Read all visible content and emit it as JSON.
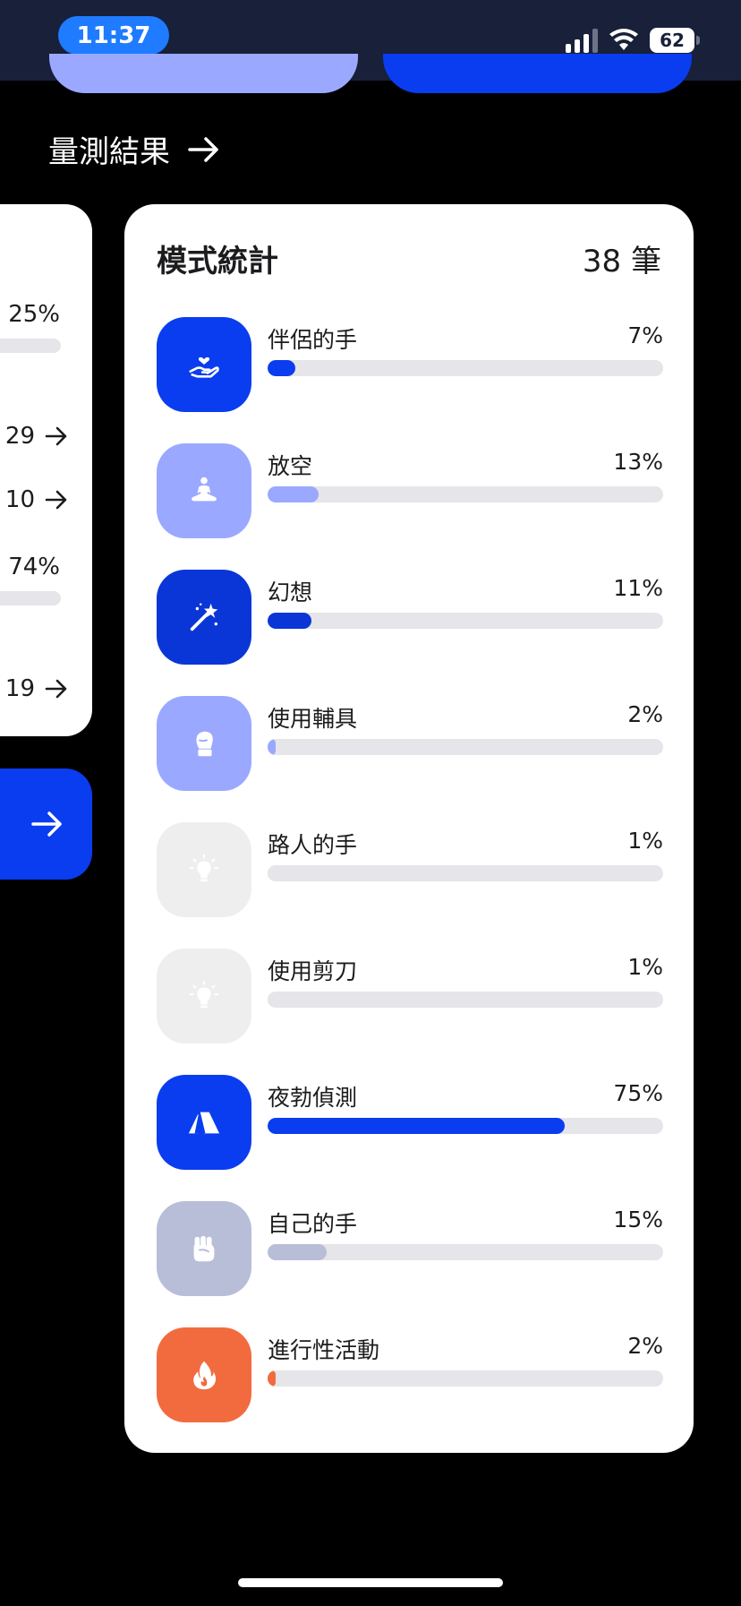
{
  "status_bar": {
    "time": "11:37",
    "battery": "62"
  },
  "section": {
    "title": "量測結果"
  },
  "left_card": {
    "rows": [
      {
        "text": "25%"
      },
      {
        "text": "29"
      },
      {
        "text": "10"
      },
      {
        "text": "74%"
      },
      {
        "text": "19"
      }
    ]
  },
  "card": {
    "title": "模式統計",
    "count": "38 筆",
    "items": [
      {
        "label": "伴侶的手",
        "percent": "7%",
        "value": 7,
        "color": "#0a3df0",
        "icon_bg": "#0a3df0",
        "icon": "hand-heart-icon"
      },
      {
        "label": "放空",
        "percent": "13%",
        "value": 13,
        "color": "#9aa9ff",
        "icon_bg": "#9aa9ff",
        "icon": "meditation-icon"
      },
      {
        "label": "幻想",
        "percent": "11%",
        "value": 11,
        "color": "#0a36d8",
        "icon_bg": "#0a36d8",
        "icon": "magic-wand-icon"
      },
      {
        "label": "使用輔具",
        "percent": "2%",
        "value": 2,
        "color": "#9aa9ff",
        "icon_bg": "#9aa9ff",
        "icon": "boxing-glove-icon"
      },
      {
        "label": "路人的手",
        "percent": "1%",
        "value": 1,
        "color": "#e5e5ea",
        "icon_bg": "#eeeeee",
        "icon": "lightbulb-icon"
      },
      {
        "label": "使用剪刀",
        "percent": "1%",
        "value": 1,
        "color": "#e5e5ea",
        "icon_bg": "#eeeeee",
        "icon": "lightbulb-icon"
      },
      {
        "label": "夜勃偵測",
        "percent": "75%",
        "value": 75,
        "color": "#0a3df0",
        "icon_bg": "#0a3df0",
        "icon": "tent-icon"
      },
      {
        "label": "自己的手",
        "percent": "15%",
        "value": 15,
        "color": "#b8bdd8",
        "icon_bg": "#b8bdd8",
        "icon": "fist-icon"
      },
      {
        "label": "進行性活動",
        "percent": "2%",
        "value": 2,
        "color": "#f26b3f",
        "icon_bg": "#f26b3f",
        "icon": "flame-icon"
      }
    ]
  }
}
